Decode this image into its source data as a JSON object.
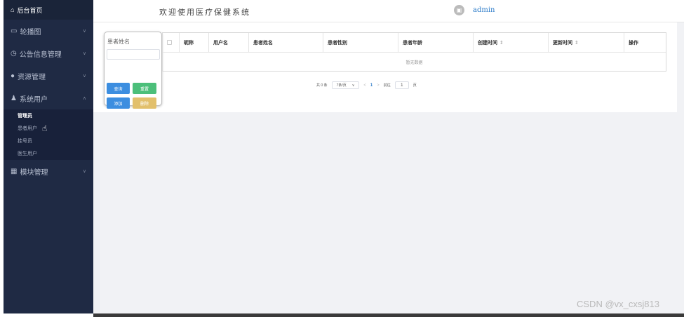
{
  "sidebar": {
    "brand": "后台首页",
    "menus": [
      {
        "label": "轮播图",
        "icon": "image-icon"
      },
      {
        "label": "公告信息管理",
        "icon": "clock-icon"
      },
      {
        "label": "资源管理",
        "icon": "location-icon"
      },
      {
        "label": "系统用户",
        "icon": "user-icon"
      }
    ],
    "sub_items": [
      "管理员",
      "患者用户",
      "挂号员",
      "医生用户"
    ],
    "module": "模块管理"
  },
  "header": {
    "title": "欢迎使用医疗保健系统",
    "username": "admin"
  },
  "search": {
    "label": "患者姓名",
    "query": "查询",
    "reset": "重置",
    "add": "添加",
    "delete": "删除"
  },
  "table": {
    "columns": [
      "昵称",
      "用户名",
      "患者姓名",
      "患者性别",
      "患者年龄",
      "创建时间",
      "更新时间",
      "操作"
    ],
    "empty_text": "暂无数据"
  },
  "pagination": {
    "total": "共 0 条",
    "page_size": "7条/页",
    "current": "1",
    "goto_label": "前往",
    "goto_value": "1",
    "page_unit": "页"
  },
  "watermark": "CSDN @vx_cxsj813"
}
